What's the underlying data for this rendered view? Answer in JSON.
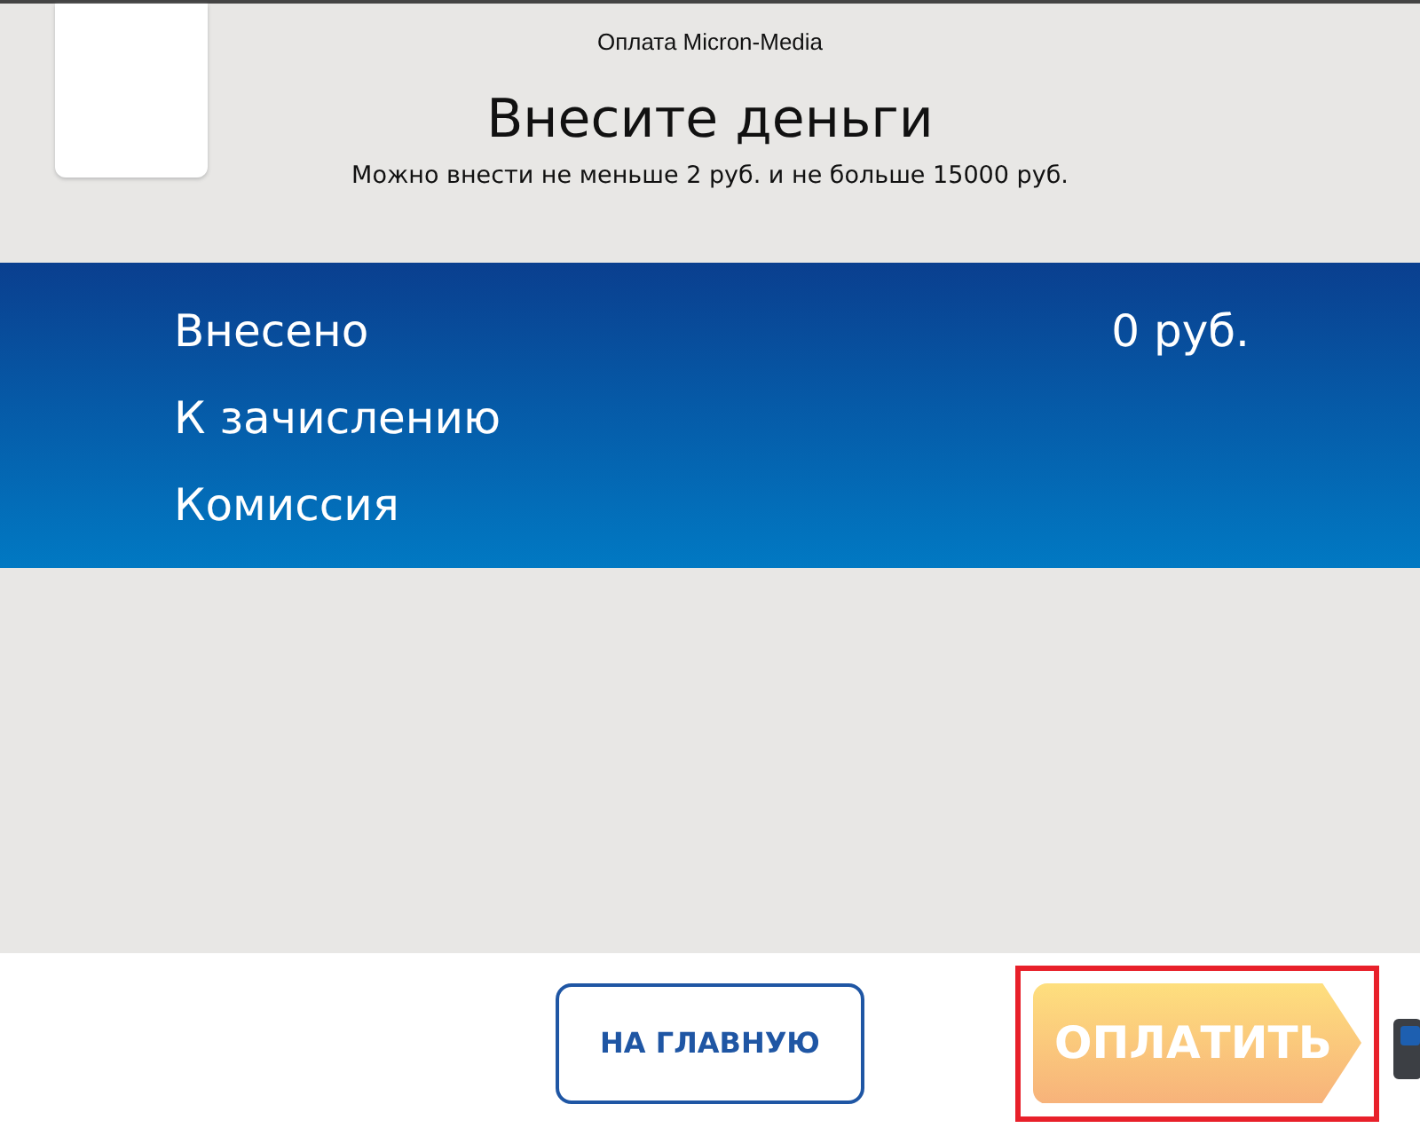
{
  "header": {
    "service": "Оплата Micron-Media",
    "title": "Внесите деньги",
    "hint": "Можно внести не меньше 2 руб. и не больше 15000 руб."
  },
  "summary": [
    {
      "label": "Внесено",
      "value": "0 руб."
    },
    {
      "label": "К зачислению"
    },
    {
      "label": "Комиссия"
    }
  ],
  "buttons": [
    {
      "kind": "secondary",
      "label": "НА ГЛАВНУЮ",
      "highlighted": false
    },
    {
      "kind": "primary",
      "label": "ОПЛАТИТЬ",
      "highlighted": true
    }
  ]
}
